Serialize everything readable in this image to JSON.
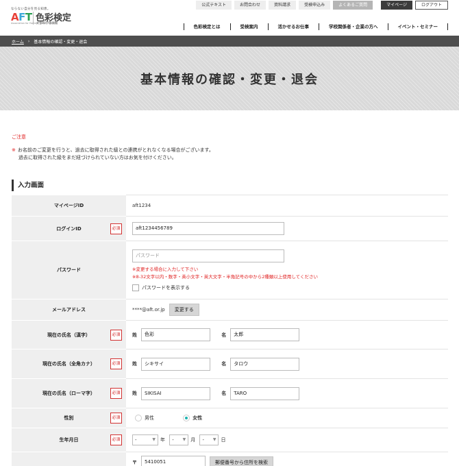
{
  "logo": {
    "tagline": "ならない自分を見る知恵。",
    "aft_a": "A",
    "aft_f": "F",
    "aft_t": "T",
    "sub": "Association for Fashion TOKYO COLOR",
    "title": "色彩検定",
    "title_sub": "文部科学省後援"
  },
  "top_links": [
    "公式テキスト",
    "お問合わせ",
    "資料請求",
    "受検申込み",
    "よくあるご質問",
    "マイページ",
    "ログアウト"
  ],
  "main_nav": [
    "色彩検定とは",
    "受検案内",
    "活かせるお仕事",
    "学校関係者・企業の方へ",
    "イベント・セミナー"
  ],
  "breadcrumb": {
    "home": "ホーム",
    "sep": "›",
    "current": "基本情報の確認・変更・退会"
  },
  "hero_title": "基本情報の確認・変更・退会",
  "notice": {
    "title": "ご注意",
    "mark": "※",
    "line1": "お名前のご変更を行うと、過去に取得された級との連携がとれなくなる場合がございます。",
    "line2": "過去に取得された級をまだ紐づけられていない方はお気を付けください。"
  },
  "section_title": "入力画面",
  "required_label": "必須",
  "form": {
    "mypage_id": {
      "label": "マイページID",
      "value": "aft1234"
    },
    "login_id": {
      "label": "ログインID",
      "value": "aft1234456789"
    },
    "password": {
      "label": "パスワード",
      "placeholder": "パスワード",
      "note1": "※変更する場合に入力して下さい",
      "note2": "※8-32文字以内・数字・英小文字・英大文字・半角記号の中から2種類以上使用してください",
      "show_label": "パスワードを表示する"
    },
    "email": {
      "label": "メールアドレス",
      "value": "****@aft.or.jp",
      "button": "変更する"
    },
    "name_kanji": {
      "label": "現在の氏名（漢字）",
      "sei_label": "姓",
      "sei": "色彩",
      "mei_label": "名",
      "mei": "太郎"
    },
    "name_kana": {
      "label": "現在の氏名（全角カナ）",
      "sei_label": "姓",
      "sei": "シキサイ",
      "mei_label": "名",
      "mei": "タロウ"
    },
    "name_roman": {
      "label": "現在の氏名（ローマ字）",
      "sei_label": "姓",
      "sei": "SIKISAI",
      "mei_label": "名",
      "mei": "TARO"
    },
    "gender": {
      "label": "性別",
      "male": "男性",
      "female": "女性",
      "selected": "female"
    },
    "birthday": {
      "label": "生年月日",
      "year": "-",
      "year_unit": "年",
      "month": "-",
      "month_unit": "月",
      "day": "-",
      "day_unit": "日"
    },
    "postal": {
      "mark": "〒",
      "value": "5410051",
      "button": "郵便番号から住所を検索"
    }
  }
}
